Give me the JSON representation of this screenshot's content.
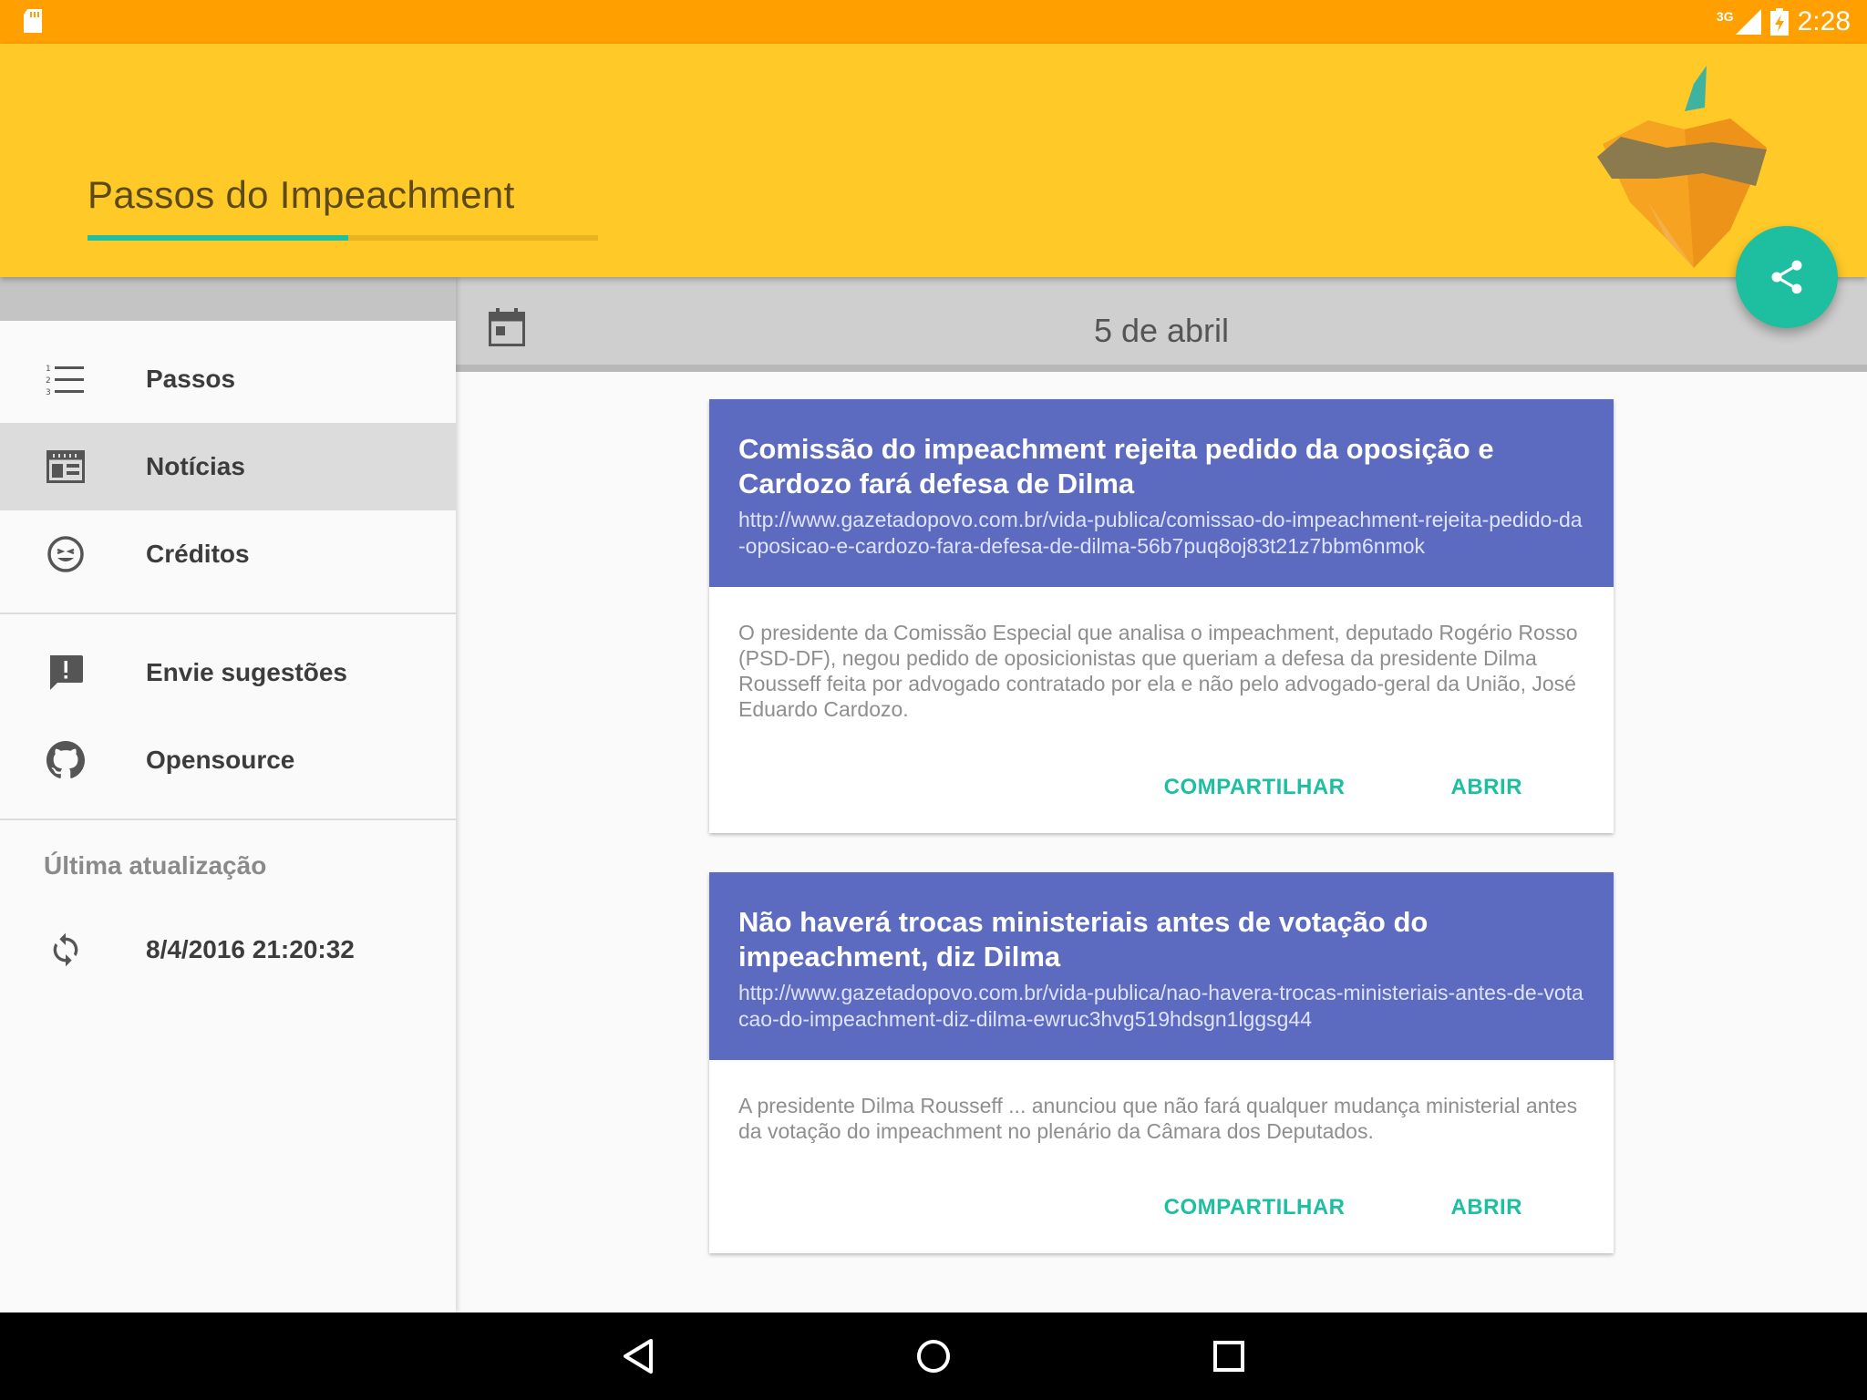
{
  "status_bar": {
    "network": "3G",
    "time": "2:28"
  },
  "app_bar": {
    "title": "Passos do Impeachment",
    "progress": 0.51
  },
  "fab": {
    "icon": "share-icon"
  },
  "drawer": {
    "items": [
      {
        "label": "Passos",
        "icon": "numbered-list-icon",
        "active": false
      },
      {
        "label": "Notícias",
        "icon": "news-icon",
        "active": true
      },
      {
        "label": "Créditos",
        "icon": "smiley-icon",
        "active": false
      },
      {
        "label": "Envie sugestões",
        "icon": "feedback-icon",
        "active": false
      },
      {
        "label": "Opensource",
        "icon": "github-icon",
        "active": false
      }
    ],
    "last_update_label": "Última atualização",
    "last_update_value": "8/4/2016 21:20:32"
  },
  "main": {
    "date": "5 de abril",
    "cards": [
      {
        "title": "Comissão do impeachment rejeita pedido da oposição e Cardozo fará defesa de Dilma",
        "url": "http://www.gazetadopovo.com.br/vida-publica/comissao-do-impeachment-rejeita-pedido-da-oposicao-e-cardozo-fara-defesa-de-dilma-56b7puq8oj83t21z7bbm6nmok",
        "summary": "O presidente da Comissão Especial que analisa o impeachment, deputado Rogério Rosso (PSD-DF), negou pedido de oposicionistas que queriam a defesa da presidente Dilma Rousseff feita por advogado contratado por ela e não pelo advogado-geral da União, José Eduardo Cardozo.",
        "share_label": "COMPARTILHAR",
        "open_label": "ABRIR"
      },
      {
        "title": "Não haverá trocas ministeriais antes de votação do impeachment, diz Dilma",
        "url": "http://www.gazetadopovo.com.br/vida-publica/nao-havera-trocas-ministeriais-antes-de-votacao-do-impeachment-diz-dilma-ewruc3hvg519hdsgn1lggsg44",
        "summary": "A presidente Dilma Rousseff ... anunciou que não fará qualquer mudança ministerial antes da votação do impeachment no plenário da Câmara dos Deputados.",
        "share_label": "COMPARTILHAR",
        "open_label": "ABRIR"
      }
    ]
  },
  "colors": {
    "status_bar": "#ffa000",
    "app_bar": "#ffca28",
    "accent": "#1dbfa0",
    "card_header": "#5c6bc0"
  }
}
